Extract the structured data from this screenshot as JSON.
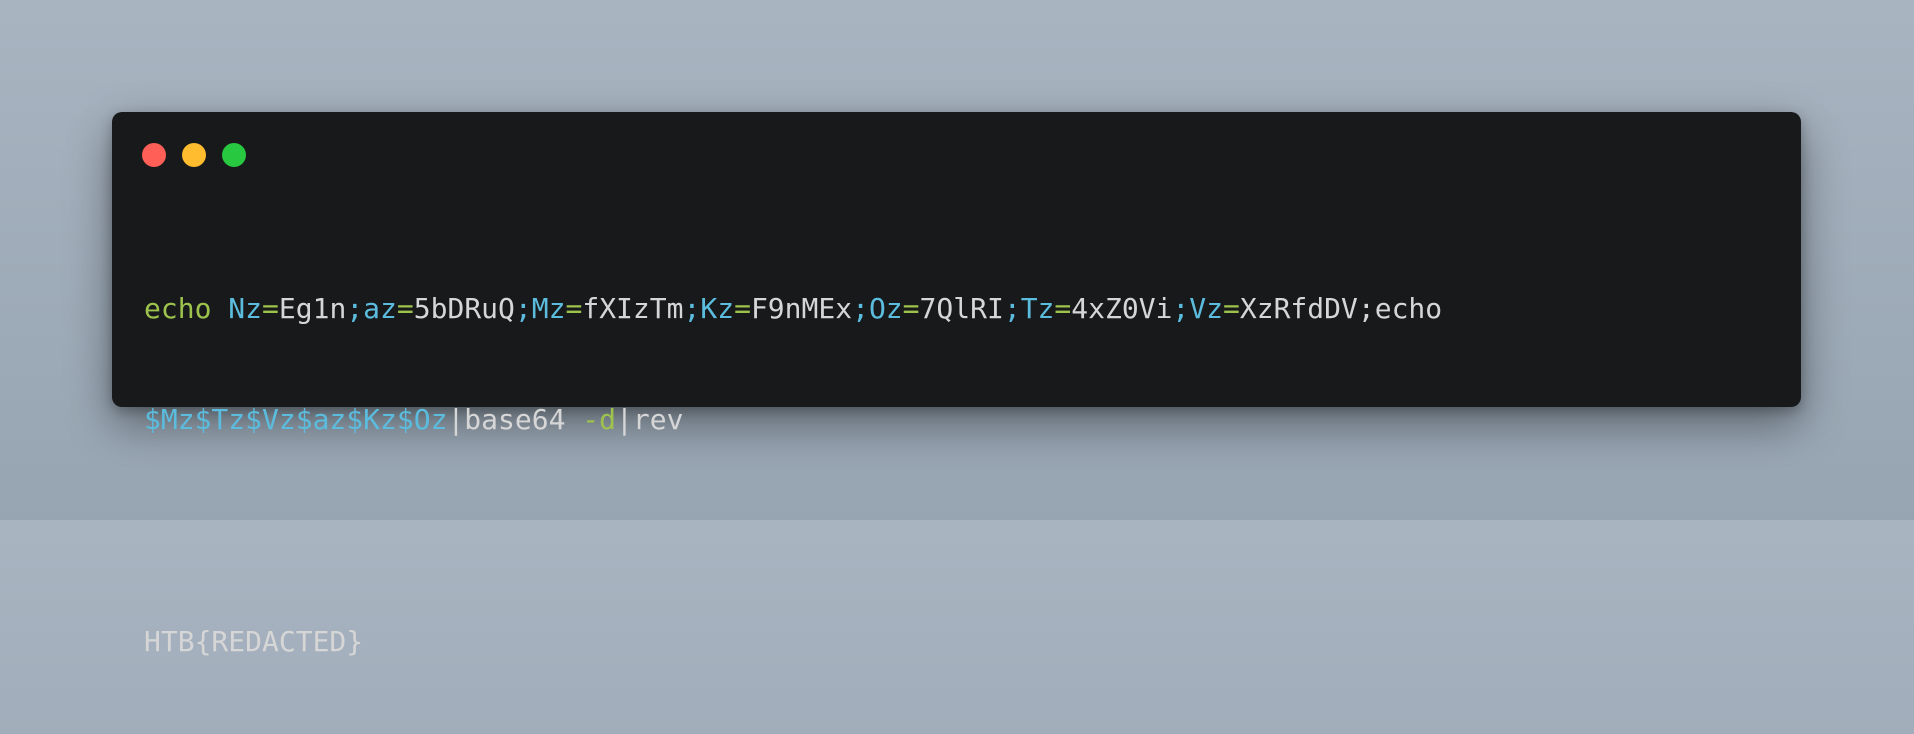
{
  "window": {
    "buttons": {
      "close_color": "#ff5f57",
      "minimize_color": "#febc2e",
      "maximize_color": "#28c840"
    }
  },
  "code": {
    "line1": [
      {
        "t": "echo",
        "c": "kw"
      },
      {
        "t": " ",
        "c": "txt"
      },
      {
        "t": "Nz",
        "c": "var"
      },
      {
        "t": "=",
        "c": "op"
      },
      {
        "t": "Eg1n",
        "c": "txt"
      },
      {
        "t": ";",
        "c": "sep"
      },
      {
        "t": "az",
        "c": "var"
      },
      {
        "t": "=",
        "c": "op"
      },
      {
        "t": "5bDRuQ",
        "c": "txt"
      },
      {
        "t": ";",
        "c": "sep"
      },
      {
        "t": "Mz",
        "c": "var"
      },
      {
        "t": "=",
        "c": "op"
      },
      {
        "t": "fXIzTm",
        "c": "txt"
      },
      {
        "t": ";",
        "c": "sep"
      },
      {
        "t": "Kz",
        "c": "var"
      },
      {
        "t": "=",
        "c": "op"
      },
      {
        "t": "F9nMEx",
        "c": "txt"
      },
      {
        "t": ";",
        "c": "sep"
      },
      {
        "t": "Oz",
        "c": "var"
      },
      {
        "t": "=",
        "c": "op"
      },
      {
        "t": "7QlRI",
        "c": "txt"
      },
      {
        "t": ";",
        "c": "sep"
      },
      {
        "t": "Tz",
        "c": "var"
      },
      {
        "t": "=",
        "c": "op"
      },
      {
        "t": "4xZ0Vi",
        "c": "txt"
      },
      {
        "t": ";",
        "c": "sep"
      },
      {
        "t": "Vz",
        "c": "var"
      },
      {
        "t": "=",
        "c": "op"
      },
      {
        "t": "XzRfdDV;echo",
        "c": "txt"
      }
    ],
    "line2": [
      {
        "t": "$Mz$Tz$Vz$az$Kz$Oz",
        "c": "var"
      },
      {
        "t": "|base64 ",
        "c": "txt"
      },
      {
        "t": "-d",
        "c": "kw"
      },
      {
        "t": "|rev",
        "c": "txt"
      }
    ],
    "output": "HTB{REDACTED}"
  }
}
